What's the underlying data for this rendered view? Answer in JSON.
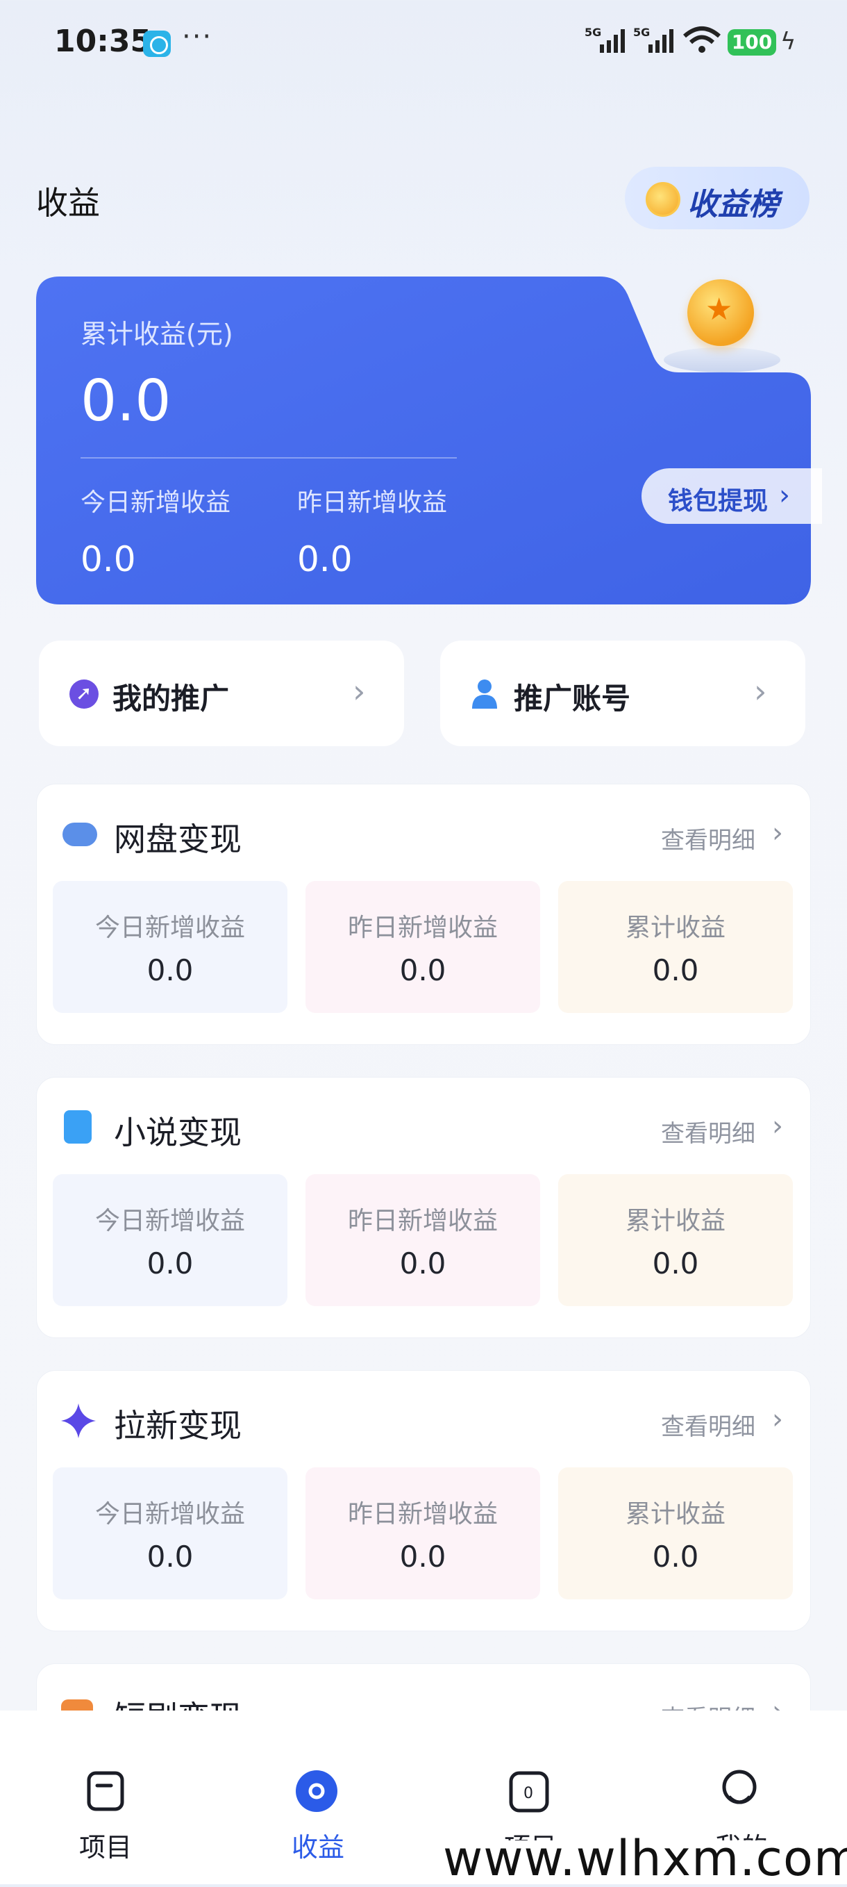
{
  "status_bar": {
    "time": "10:35",
    "dots": "···",
    "net1": "5G",
    "net2": "5G",
    "battery": "100"
  },
  "header": {
    "title": "收益",
    "rank_button": "收益榜"
  },
  "earnings": {
    "cumulative_label": "累计收益(元)",
    "cumulative_value": "0.0",
    "today_label": "今日新增收益",
    "today_value": "0.0",
    "yesterday_label": "昨日新增收益",
    "yesterday_value": "0.0",
    "wallet_button": "钱包提现"
  },
  "promo": {
    "my_promo": "我的推广",
    "promo_account": "推广账号"
  },
  "sections": [
    {
      "title": "网盘变现",
      "link": "查看明细",
      "today_label": "今日新增收益",
      "today": "0.0",
      "yesterday_label": "昨日新增收益",
      "yesterday": "0.0",
      "total_label": "累计收益",
      "total": "0.0"
    },
    {
      "title": "小说变现",
      "link": "查看明细",
      "today_label": "今日新增收益",
      "today": "0.0",
      "yesterday_label": "昨日新增收益",
      "yesterday": "0.0",
      "total_label": "累计收益",
      "total": "0.0"
    },
    {
      "title": "拉新变现",
      "link": "查看明细",
      "today_label": "今日新增收益",
      "today": "0.0",
      "yesterday_label": "昨日新增收益",
      "yesterday": "0.0",
      "total_label": "累计收益",
      "total": "0.0"
    },
    {
      "title": "短剧变现",
      "link": "查看明细"
    }
  ],
  "nav": {
    "items": [
      {
        "label": "项目"
      },
      {
        "label": "收益"
      },
      {
        "label": "项目"
      },
      {
        "label": "我的"
      }
    ],
    "active_color": "#2b5be8"
  },
  "watermark": "www.wlhxm.com",
  "colors": {
    "card_blue": "#4a6ef0",
    "accent": "#2b5be8"
  }
}
